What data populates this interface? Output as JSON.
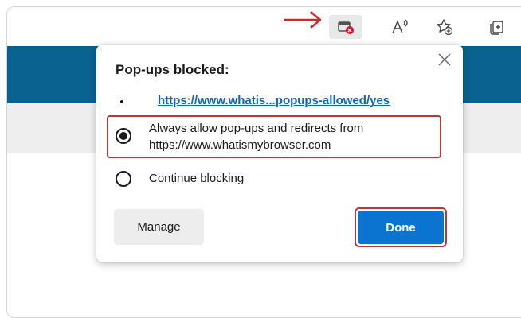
{
  "dialog": {
    "title": "Pop-ups blocked:",
    "blocked_url": "https://www.whatis...popups-allowed/yes",
    "options": [
      {
        "label_line1": "Always allow pop-ups and redirects from",
        "label_line2": "https://www.whatismybrowser.com",
        "selected": true
      },
      {
        "label_line1": "Continue blocking",
        "selected": false
      }
    ],
    "manage_label": "Manage",
    "done_label": "Done"
  },
  "toolbar": {
    "icons": [
      "popup-blocked-icon",
      "read-aloud-icon",
      "favorites-add-icon",
      "collections-icon"
    ]
  },
  "colors": {
    "accent": "#0b73d0",
    "highlight": "#b23a3e",
    "page_band": "#0a6290",
    "blocked_badge": "#e81123"
  }
}
